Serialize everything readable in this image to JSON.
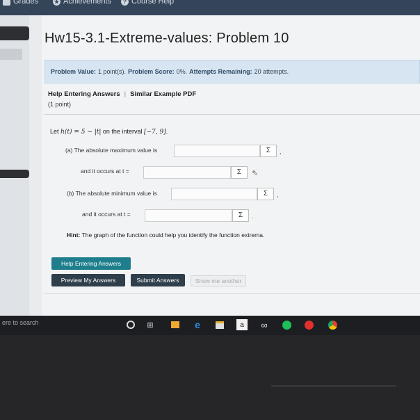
{
  "topnav": {
    "grades": "Grades",
    "achievements": "Achievements",
    "course_help": "Course Help"
  },
  "page_title": "Hw15-3.1-Extreme-values: Problem 10",
  "problem_info": {
    "value_label": "Problem Value:",
    "value_text": "1 point(s).",
    "score_label": "Problem Score:",
    "score_text": "0%.",
    "attempts_label": "Attempts Remaining:",
    "attempts_text": "20 attempts."
  },
  "help_links": {
    "help_entering": "Help Entering Answers",
    "separator": "|",
    "similar_example": "Similar Example PDF"
  },
  "points": "(1 point)",
  "problem": {
    "prefix": "Let",
    "function": "h(t) = 5 − |t|",
    "middle": "on the interval",
    "interval": "[−7, 9]",
    "suffix": "."
  },
  "questions": {
    "a_max": "(a) The absolute maximum value is",
    "a_at": "and it occurs at t =",
    "b_min": "(b) The absolute minimum value is",
    "b_at": "and it occurs at t ="
  },
  "sigma_symbol": "Σ",
  "hint": {
    "label": "Hint:",
    "text": "The graph of the function could help you identify the function extrema."
  },
  "buttons": {
    "help_entering": "Help Entering Answers",
    "preview": "Preview My Answers",
    "submit": "Submit Answers",
    "show_another": "Show me another"
  },
  "taskbar": {
    "search": "ere to search",
    "icons": [
      "cortana-icon",
      "task-view-icon",
      "store-icon",
      "edge-icon",
      "calendar-icon",
      "amazon-icon",
      "infinity-icon",
      "spotify-icon",
      "app-icon",
      "chrome-icon"
    ],
    "amazon_label": "a",
    "infinity_label": "∞"
  },
  "colors": {
    "accent_teal": "#1f7e8c",
    "dark_button": "#2f3e4b",
    "info_bg": "#d7e5f2",
    "topbar": "#34455a"
  }
}
